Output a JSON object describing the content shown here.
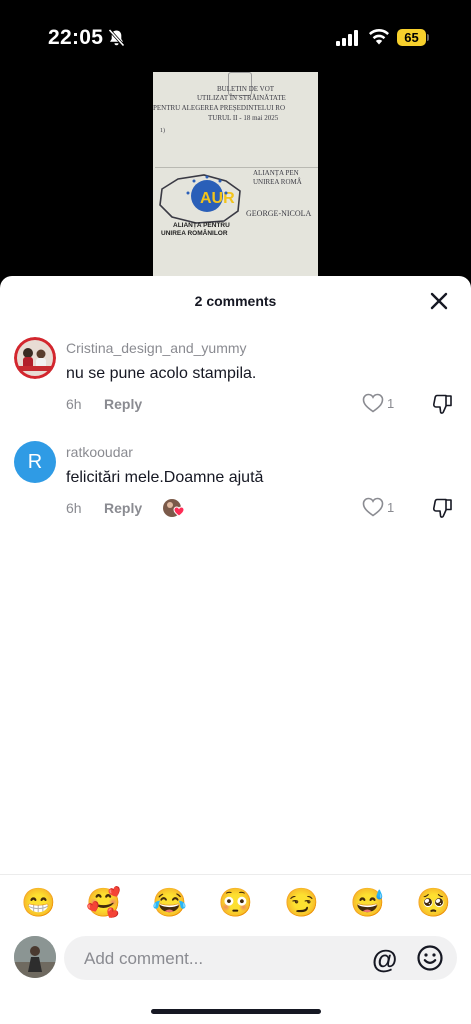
{
  "status": {
    "time": "22:05",
    "battery": "65",
    "icons": [
      "bell-slash-icon",
      "cellular-signal-icon",
      "wifi-icon",
      "battery-icon"
    ]
  },
  "video": {
    "ballot_lines": [
      "BULETIN DE VOT",
      "UTILIZAT ÎN STRĂINĂTATE",
      "PENTRU ALEGEREA PREȘEDINTELUI RO",
      "TURUL II - 18 mai 2025"
    ],
    "ballot_number": "1)",
    "party_line1": "ALIANȚA PEN",
    "party_line2": "UNIREA ROMÂ",
    "candidate": "GEORGE-NICOLA",
    "logo_text": "AUR",
    "logo_caption1": "ALIANȚA PENTRU",
    "logo_caption2": "UNIREA ROMÂNILOR"
  },
  "sheet": {
    "title": "2 comments",
    "close_icon": "close-icon"
  },
  "comments": [
    {
      "username": "Cristina_design_and_yummy",
      "text": "nu se pune acolo stampila.",
      "time": "6h",
      "reply_label": "Reply",
      "likes": "1",
      "avatar_type": "photo"
    },
    {
      "username": "ratkooudar",
      "text": "felicitări mele.Doamne ajută",
      "time": "6h",
      "reply_label": "Reply",
      "likes": "1",
      "avatar_letter": "R",
      "avatar_color": "#2f9be5",
      "creator_liked": true
    }
  ],
  "emojis": [
    "😁",
    "🥰",
    "😂",
    "😳",
    "😏",
    "😅",
    "🥺"
  ],
  "composer": {
    "placeholder": "Add comment...",
    "at_label": "@"
  },
  "colors": {
    "secondary_text": "#8a8b91",
    "primary_text": "#161823",
    "battery": "#f7d02c"
  }
}
